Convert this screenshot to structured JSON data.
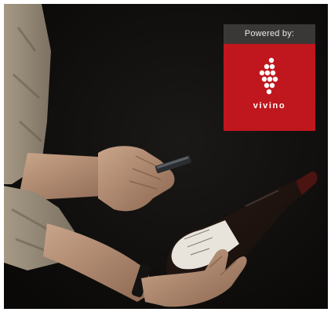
{
  "badge": {
    "header_text": "Powered by:",
    "brand_wordmark": "vivino",
    "brand_color": "#c0161d",
    "header_color": "#3a3836"
  },
  "photo": {
    "background_color": "#0e0d0c"
  }
}
